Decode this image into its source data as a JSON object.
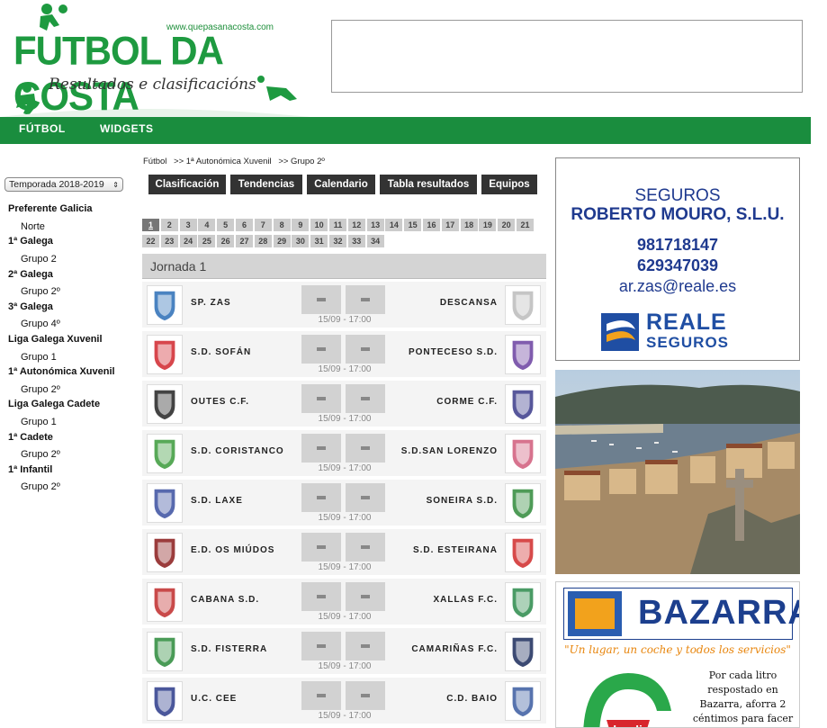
{
  "header": {
    "logo_url": "www.quepasanacosta.com",
    "logo_title": "FUTBOL DA COSTA",
    "logo_subtitle": "Resultados e clasificacións"
  },
  "nav": {
    "items": [
      "FÚTBOL",
      "WIDGETS"
    ]
  },
  "sidebar": {
    "season": "Temporada 2018-2019",
    "sections": [
      {
        "name": "Preferente Galicia",
        "groups": [
          "Norte"
        ]
      },
      {
        "name": "1ª Galega",
        "groups": [
          "Grupo 2"
        ]
      },
      {
        "name": "2ª Galega",
        "groups": [
          "Grupo 2º"
        ]
      },
      {
        "name": "3ª Galega",
        "groups": [
          "Grupo 4º"
        ]
      },
      {
        "name": "Liga Galega Xuvenil",
        "groups": [
          "Grupo 1"
        ]
      },
      {
        "name": "1ª Autonómica Xuvenil",
        "groups": [
          "Grupo 2º"
        ]
      },
      {
        "name": "Liga Galega Cadete",
        "groups": [
          "Grupo 1"
        ]
      },
      {
        "name": "1ª Cadete",
        "groups": [
          "Grupo 2º"
        ]
      },
      {
        "name": "1ª Infantil",
        "groups": [
          "Grupo 2º"
        ]
      }
    ]
  },
  "breadcrumb": [
    "Fútbol",
    ">> 1ª Autonómica Xuvenil",
    ">> Grupo 2º"
  ],
  "tabs": [
    "Clasificación",
    "Tendencias",
    "Calendario",
    "Tabla resultados",
    "Equipos"
  ],
  "rounds": [
    "1",
    "2",
    "3",
    "4",
    "5",
    "6",
    "7",
    "8",
    "9",
    "10",
    "11",
    "12",
    "13",
    "14",
    "15",
    "16",
    "17",
    "18",
    "19",
    "20",
    "21",
    "22",
    "23",
    "24",
    "25",
    "26",
    "27",
    "28",
    "29",
    "30",
    "31",
    "32",
    "33",
    "34"
  ],
  "active_round": "1",
  "jornada_title": "Jornada 1",
  "matches": [
    {
      "home": "SP. ZAS",
      "away": "DESCANSA",
      "date": "15/09 - 17:00",
      "home_color": "#2a6db6",
      "away_color": "#bbbbbb"
    },
    {
      "home": "S.D. SOFÁN",
      "away": "PONTECESO S.D.",
      "date": "15/09 - 17:00",
      "home_color": "#d0262d",
      "away_color": "#6a3fa0"
    },
    {
      "home": "OUTES C.F.",
      "away": "CORME C.F.",
      "date": "15/09 - 17:00",
      "home_color": "#222222",
      "away_color": "#3a3a8a"
    },
    {
      "home": "S.D. CORISTANCO",
      "away": "S.D.SAN LORENZO",
      "date": "15/09 - 17:00",
      "home_color": "#3a9a3a",
      "away_color": "#d05a7a"
    },
    {
      "home": "S.D. LAXE",
      "away": "SONEIRA S.D.",
      "date": "15/09 - 17:00",
      "home_color": "#3a4fa0",
      "away_color": "#2f8a3a"
    },
    {
      "home": "E.D. OS MIÚDOS",
      "away": "S.D. ESTEIRANA",
      "date": "15/09 - 17:00",
      "home_color": "#8a1a1a",
      "away_color": "#d02a2a"
    },
    {
      "home": "CABANA S.D.",
      "away": "XALLAS F.C.",
      "date": "15/09 - 17:00",
      "home_color": "#c02a2a",
      "away_color": "#2a8a4a"
    },
    {
      "home": "S.D. FISTERRA",
      "away": "CAMARIÑAS F.C.",
      "date": "15/09 - 17:00",
      "home_color": "#2a8a3a",
      "away_color": "#1a2a5a"
    },
    {
      "home": "U.C. CEE",
      "away": "C.D. BAIO",
      "date": "15/09 - 17:00",
      "home_color": "#2a3a8a",
      "away_color": "#3a5aa0"
    }
  ],
  "ads": {
    "seguros": {
      "line1": "SEGUROS",
      "line2": "ROBERTO MOURO, S.L.U.",
      "phone1": "981718147",
      "phone2": "629347039",
      "email": "ar.zas@reale.es",
      "brand1": "REALE",
      "brand2": "SEGUROS"
    },
    "bazarra": {
      "name": "BAZARRA",
      "slogan": "\"Un lugar, un coche y todos los servicios\"",
      "claudio_text": "Por cada litro respostado en Bazarra, aforra 2 céntimos para facer",
      "claudio_logo": "claudio"
    }
  },
  "colors": {
    "nav_green": "#1a8d3e",
    "tab_dark": "#333333",
    "brand_blue": "#1f3a8f"
  }
}
